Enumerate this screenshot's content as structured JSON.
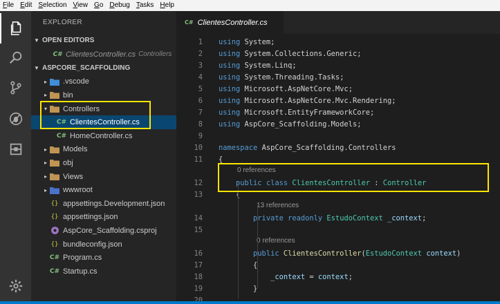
{
  "menu": [
    "File",
    "Edit",
    "Selection",
    "View",
    "Go",
    "Debug",
    "Tasks",
    "Help"
  ],
  "menu_mnemonic": [
    "F",
    "E",
    "S",
    "V",
    "G",
    "D",
    "T",
    "H"
  ],
  "activity_icons": [
    "files-icon",
    "search-icon",
    "source-control-icon",
    "debug-icon",
    "extensions-icon",
    "settings-gear-icon"
  ],
  "sidebar": {
    "title": "EXPLORER",
    "open_editors_label": "OPEN EDITORS",
    "open_editor": {
      "name": "ClientesController.cs",
      "folder": "Controllers"
    },
    "project_label": "ASPCORE_SCAFFOLDING",
    "tree": [
      {
        "name": ".vscode",
        "kind": "folder-vscode",
        "expanded": false,
        "indent": 0
      },
      {
        "name": "bin",
        "kind": "folder",
        "expanded": false,
        "indent": 0
      },
      {
        "name": "Controllers",
        "kind": "folder-open",
        "expanded": true,
        "indent": 0
      },
      {
        "name": "ClientesController.cs",
        "kind": "cs",
        "indent": 1,
        "selected": true
      },
      {
        "name": "HomeController.cs",
        "kind": "cs",
        "indent": 1
      },
      {
        "name": "Models",
        "kind": "folder",
        "expanded": false,
        "indent": 0
      },
      {
        "name": "obj",
        "kind": "folder",
        "expanded": false,
        "indent": 0
      },
      {
        "name": "Views",
        "kind": "folder",
        "expanded": false,
        "indent": 0
      },
      {
        "name": "wwwroot",
        "kind": "folder-www",
        "expanded": false,
        "indent": 0
      },
      {
        "name": "appsettings.Development.json",
        "kind": "json",
        "indent": 0
      },
      {
        "name": "appsettings.json",
        "kind": "json",
        "indent": 0
      },
      {
        "name": "AspCore_Scaffolding.csproj",
        "kind": "csproj",
        "indent": 0
      },
      {
        "name": "bundleconfig.json",
        "kind": "json",
        "indent": 0
      },
      {
        "name": "Program.cs",
        "kind": "cs",
        "indent": 0
      },
      {
        "name": "Startup.cs",
        "kind": "cs",
        "indent": 0
      }
    ]
  },
  "tab": {
    "icon": "C#",
    "label": "ClientesController.cs"
  },
  "editor": {
    "lines": [
      {
        "n": "1",
        "tokens": [
          [
            "kw",
            "using"
          ],
          [
            "pl",
            " "
          ],
          [
            "ns",
            "System"
          ],
          [
            "pl",
            ";"
          ]
        ]
      },
      {
        "n": "2",
        "tokens": [
          [
            "kw",
            "using"
          ],
          [
            "pl",
            " "
          ],
          [
            "ns",
            "System.Collections.Generic"
          ],
          [
            "pl",
            ";"
          ]
        ]
      },
      {
        "n": "3",
        "tokens": [
          [
            "kw",
            "using"
          ],
          [
            "pl",
            " "
          ],
          [
            "ns",
            "System.Linq"
          ],
          [
            "pl",
            ";"
          ]
        ]
      },
      {
        "n": "4",
        "tokens": [
          [
            "kw",
            "using"
          ],
          [
            "pl",
            " "
          ],
          [
            "ns",
            "System.Threading.Tasks"
          ],
          [
            "pl",
            ";"
          ]
        ]
      },
      {
        "n": "5",
        "tokens": [
          [
            "kw",
            "using"
          ],
          [
            "pl",
            " "
          ],
          [
            "ns",
            "Microsoft.AspNetCore.Mvc"
          ],
          [
            "pl",
            ";"
          ]
        ]
      },
      {
        "n": "6",
        "tokens": [
          [
            "kw",
            "using"
          ],
          [
            "pl",
            " "
          ],
          [
            "ns",
            "Microsoft.AspNetCore.Mvc.Rendering"
          ],
          [
            "pl",
            ";"
          ]
        ]
      },
      {
        "n": "7",
        "tokens": [
          [
            "kw",
            "using"
          ],
          [
            "pl",
            " "
          ],
          [
            "ns",
            "Microsoft.EntityFrameworkCore"
          ],
          [
            "pl",
            ";"
          ]
        ]
      },
      {
        "n": "8",
        "tokens": [
          [
            "kw",
            "using"
          ],
          [
            "pl",
            " "
          ],
          [
            "ns",
            "AspCore_Scaffolding.Models"
          ],
          [
            "pl",
            ";"
          ]
        ]
      },
      {
        "n": "9",
        "tokens": []
      },
      {
        "n": "10",
        "tokens": [
          [
            "kw",
            "namespace"
          ],
          [
            "pl",
            " "
          ],
          [
            "ns",
            "AspCore_Scaffolding.Controllers"
          ]
        ]
      },
      {
        "n": "11",
        "tokens": [
          [
            "pl",
            "{"
          ]
        ]
      },
      {
        "lens": "0 references"
      },
      {
        "n": "12",
        "tokens": [
          [
            "pl",
            "    "
          ],
          [
            "kw",
            "public"
          ],
          [
            "pl",
            " "
          ],
          [
            "kw",
            "class"
          ],
          [
            "pl",
            " "
          ],
          [
            "ty",
            "ClientesController"
          ],
          [
            "pl",
            " : "
          ],
          [
            "ty",
            "Controller"
          ]
        ]
      },
      {
        "n": "13",
        "tokens": [
          [
            "pl",
            "    {"
          ]
        ]
      },
      {
        "lens": "13 references",
        "indent": 2
      },
      {
        "n": "14",
        "tokens": [
          [
            "pl",
            "        "
          ],
          [
            "kw",
            "private"
          ],
          [
            "pl",
            " "
          ],
          [
            "kw",
            "readonly"
          ],
          [
            "pl",
            " "
          ],
          [
            "ty",
            "EstudoContext"
          ],
          [
            "pl",
            " "
          ],
          [
            "id",
            "_context"
          ],
          [
            "pl",
            ";"
          ]
        ]
      },
      {
        "n": "15",
        "tokens": []
      },
      {
        "lens": "0 references",
        "indent": 2
      },
      {
        "n": "16",
        "tokens": [
          [
            "pl",
            "        "
          ],
          [
            "kw",
            "public"
          ],
          [
            "pl",
            " "
          ],
          [
            "fn",
            "ClientesController"
          ],
          [
            "pl",
            "("
          ],
          [
            "ty",
            "EstudoContext"
          ],
          [
            "pl",
            " "
          ],
          [
            "id",
            "context"
          ],
          [
            "pl",
            ")"
          ]
        ]
      },
      {
        "n": "17",
        "tokens": [
          [
            "pl",
            "        {"
          ]
        ]
      },
      {
        "n": "18",
        "tokens": [
          [
            "pl",
            "            "
          ],
          [
            "id",
            "_context"
          ],
          [
            "pl",
            " = "
          ],
          [
            "id",
            "context"
          ],
          [
            "pl",
            ";"
          ]
        ]
      },
      {
        "n": "19",
        "tokens": [
          [
            "pl",
            "        }"
          ]
        ]
      },
      {
        "n": "20",
        "tokens": []
      }
    ]
  },
  "colors": {
    "highlight": "#ffe600",
    "selection": "#094771",
    "accent": "#007acc"
  }
}
